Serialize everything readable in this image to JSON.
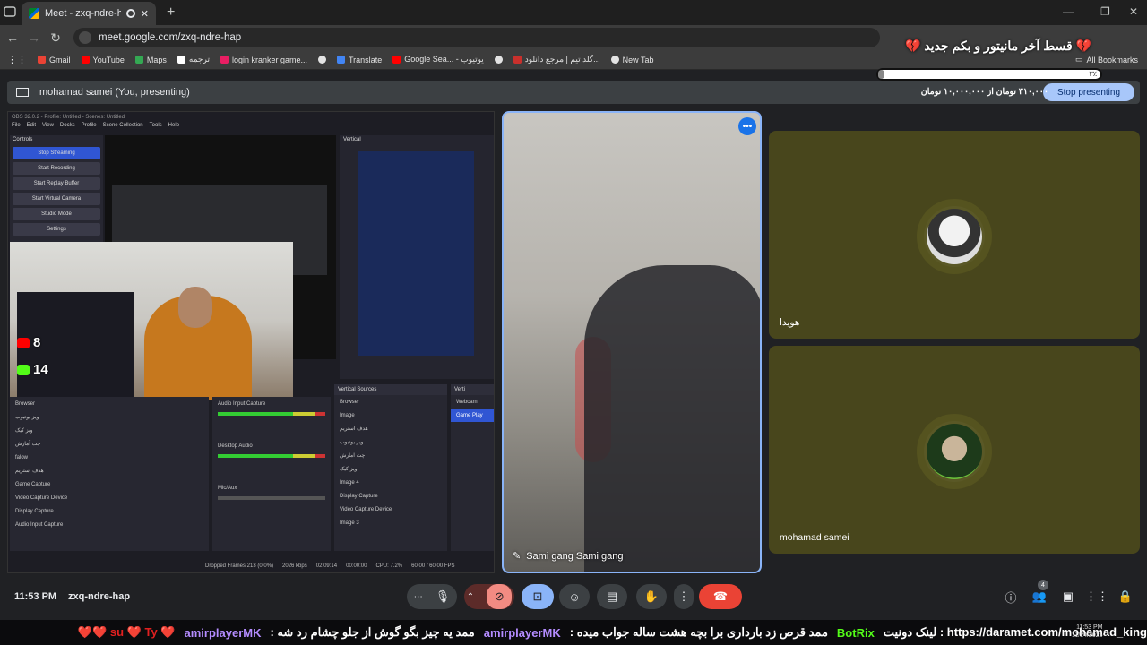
{
  "browser": {
    "tab_title": "Meet - zxq-ndre-hap",
    "url": "meet.google.com/zxq-ndre-hap",
    "new_tab_symbol": "+",
    "bookmarks": [
      {
        "label": "Gmail",
        "color": "#ea4335"
      },
      {
        "label": "YouTube",
        "color": "#ff0000"
      },
      {
        "label": "Maps",
        "color": "#34a853"
      },
      {
        "label": "ترجمه",
        "color": "#ffffff"
      },
      {
        "label": "login kranker game...",
        "color": "#e91e63"
      },
      {
        "label": "",
        "color": "#e3e3e3"
      },
      {
        "label": "Translate",
        "color": "#4285f4"
      },
      {
        "label": "Google Sea... - یوتیوب",
        "color": "#ff0000"
      },
      {
        "label": "",
        "color": "#e3e3e3"
      },
      {
        "label": "گلد تیم | مرجع دانلود...",
        "color": "#c9302c"
      },
      {
        "label": "New Tab",
        "color": "#e3e3e3"
      }
    ],
    "all_bookmarks": "All Bookmarks"
  },
  "overlay": {
    "goal_title": "💔 قسط آخر مانیتور و بکم جدید 💔",
    "goal_percent_label": "۳٪",
    "goal_fraction": 0.03,
    "goal_amount": "۳۱۰,۰۰۰ تومان از ۱۰,۰۰۰,۰۰۰ تومان"
  },
  "meet": {
    "presenting_label": "mohamad samei (You, presenting)",
    "stop_presenting": "Stop presenting",
    "main_participant": "Sami gang Sami gang",
    "participants": [
      {
        "name": "هویدا"
      },
      {
        "name": "mohamad samei"
      }
    ],
    "clock": "11:53 PM",
    "meeting_code": "zxq-ndre-hap",
    "people_count": "4"
  },
  "obs": {
    "title": "OBS 32.0.2 - Profile: Untitled - Scenes: Untitled",
    "menu": [
      "File",
      "Edit",
      "View",
      "Docks",
      "Profile",
      "Scene Collection",
      "Tools",
      "Help"
    ],
    "controls_title": "Controls",
    "controls": [
      "Stop Streaming",
      "Start Recording",
      "Start Replay Buffer",
      "Start Virtual Camera",
      "Studio Mode",
      "Settings"
    ],
    "vertical_title": "Vertical",
    "stats": [
      {
        "value": "8",
        "color": "#ff0000"
      },
      {
        "value": "14",
        "color": "#53fc18"
      }
    ],
    "sources": [
      "Browser",
      "ویز یوتیوب",
      "ویز کیک",
      "چت آمارش",
      "falow",
      "هدف استریم",
      "Game Capture",
      "Video Capture Device",
      "Display Capture",
      "Audio Input Capture"
    ],
    "mixer": [
      "Audio Input Capture",
      "Desktop Audio",
      "Mic/Aux"
    ],
    "vertical_sources_title": "Vertical Sources",
    "vertical_sources": [
      "Browser",
      "Image",
      "هدف استریم",
      "ویز یوتیوب",
      "چت آمارش",
      "ویز کیک",
      "Image 4",
      "Display Capture",
      "Video Capture Device",
      "Image 3"
    ],
    "vertical_scenes": [
      "Webcam",
      "Game Play"
    ],
    "status": [
      "Dropped Frames 213 (0.0%)",
      "2026 kbps",
      "02:09:14",
      "00:00:00",
      "CPU: 7.2%",
      "60.00 / 60.00 FPS"
    ]
  },
  "ticker": {
    "segments": [
      {
        "text": "https://daramet.com/mohamad_king : لینک دونیت",
        "style": "white"
      },
      {
        "text": "BotRix",
        "style": "green"
      },
      {
        "text": "ممد قرص زد بارداری برا بچه هشت ساله جواب میده :",
        "style": "white"
      },
      {
        "text": "amirplayerMK",
        "style": "purple"
      },
      {
        "text": "ممد یه چیز بگو گوش از جلو چشام رد شه :",
        "style": "white"
      },
      {
        "text": "amirplayerMK",
        "style": "purple"
      },
      {
        "text": "❤️ su ❤️ Ty ❤️❤️",
        "style": "heart"
      }
    ],
    "task_time": "11:53 PM",
    "task_date": "11/24/2025"
  }
}
